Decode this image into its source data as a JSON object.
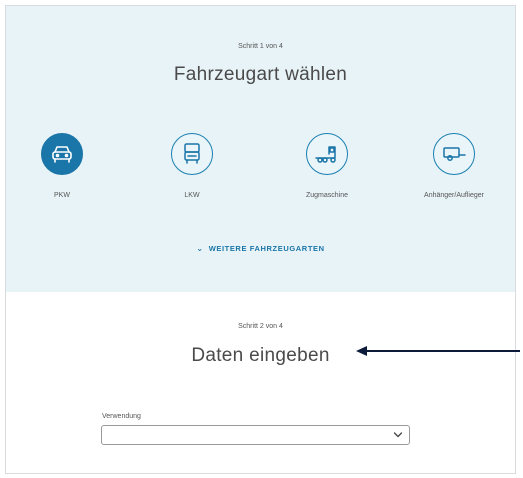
{
  "step1": {
    "label": "Schritt 1 von 4",
    "title": "Fahrzeugart wählen",
    "vehicles": [
      {
        "label": "PKW",
        "icon": "car-icon",
        "selected": true
      },
      {
        "label": "LKW",
        "icon": "truck-icon",
        "selected": false
      },
      {
        "label": "Zugmaschine",
        "icon": "tractor-unit-icon",
        "selected": false
      },
      {
        "label": "Anhänger/Auflieger",
        "icon": "trailer-icon",
        "selected": false
      }
    ],
    "more_link": "WEITERE FAHRZEUGARTEN"
  },
  "step2": {
    "label": "Schritt 2 von 4",
    "title": "Daten eingeben",
    "field_label": "Verwendung",
    "select_value": ""
  },
  "colors": {
    "accent": "#1a75a8",
    "step1_background": "#e8f3f8",
    "annotation_arrow": "#0d1b3a"
  }
}
